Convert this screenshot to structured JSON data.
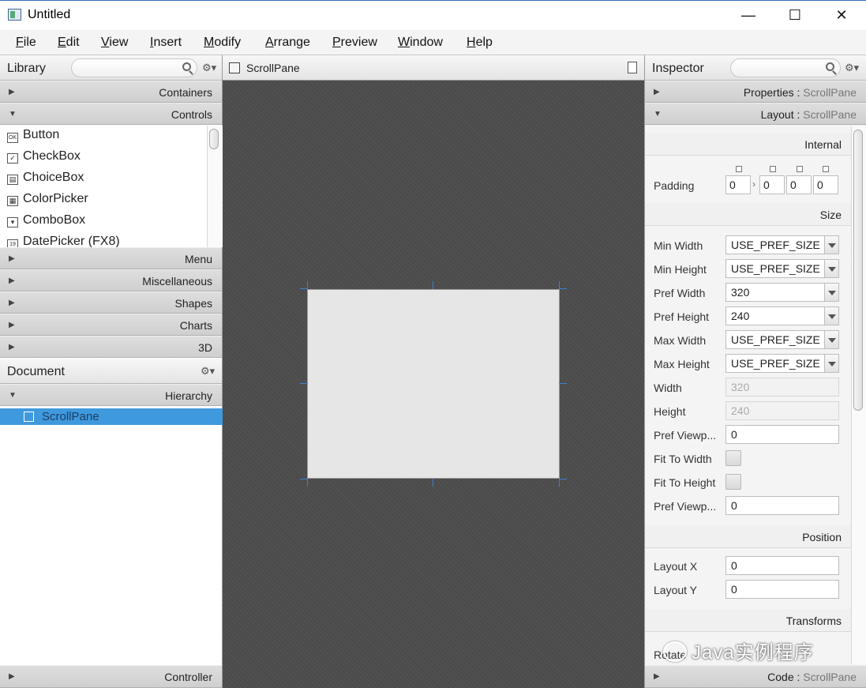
{
  "window": {
    "title": "Untitled",
    "controls": {
      "minimize": "—",
      "maximize": "☐",
      "close": "✕"
    }
  },
  "menubar": {
    "items": [
      {
        "label": "File",
        "u": "F",
        "rest": "ile"
      },
      {
        "label": "Edit",
        "u": "E",
        "rest": "dit"
      },
      {
        "label": "View",
        "u": "V",
        "rest": "iew"
      },
      {
        "label": "Insert",
        "u": "I",
        "rest": "nsert"
      },
      {
        "label": "Modify",
        "u": "M",
        "rest": "odify"
      },
      {
        "label": "Arrange",
        "u": "A",
        "rest": "rrange"
      },
      {
        "label": "Preview",
        "u": "P",
        "rest": "review"
      },
      {
        "label": "Window",
        "u": "W",
        "rest": "indow"
      },
      {
        "label": "Help",
        "u": "H",
        "rest": "elp"
      }
    ]
  },
  "library": {
    "title": "Library",
    "search_value": "",
    "sections": {
      "containers": "Containers",
      "controls": "Controls",
      "menu": "Menu",
      "miscellaneous": "Miscellaneous",
      "shapes": "Shapes",
      "charts": "Charts",
      "three_d": "3D"
    },
    "controls_items": [
      {
        "label": "Button",
        "icon": "ok-button-icon",
        "glyph": "OK"
      },
      {
        "label": "CheckBox",
        "icon": "checkbox-icon",
        "glyph": "✓"
      },
      {
        "label": "ChoiceBox",
        "icon": "choicebox-icon",
        "glyph": "▤"
      },
      {
        "label": "ColorPicker",
        "icon": "colorpicker-icon",
        "glyph": "▦"
      },
      {
        "label": "ComboBox",
        "icon": "combobox-icon",
        "glyph": "▾"
      },
      {
        "label": "DatePicker  (FX8)",
        "icon": "datepicker-icon",
        "glyph": "19"
      }
    ]
  },
  "document": {
    "title": "Document",
    "sections": {
      "hierarchy": "Hierarchy",
      "controller": "Controller"
    },
    "hierarchy_items": [
      {
        "label": "ScrollPane",
        "selected": true
      }
    ]
  },
  "content": {
    "tab_label": "ScrollPane"
  },
  "inspector": {
    "title": "Inspector",
    "search_value": "",
    "sections": {
      "properties": {
        "label": "Properties",
        "sep": " : ",
        "target": "ScrollPane"
      },
      "layout": {
        "label": "Layout",
        "sep": " : ",
        "target": "ScrollPane"
      },
      "code": {
        "label": "Code",
        "sep": " : ",
        "target": "ScrollPane"
      }
    },
    "groups": {
      "internal": "Internal",
      "size": "Size",
      "position": "Position",
      "transforms": "Transforms"
    },
    "padding": {
      "label": "Padding",
      "values": [
        "0",
        "0",
        "0",
        "0"
      ],
      "separator": "›"
    },
    "size_props": [
      {
        "label": "Min Width",
        "type": "combo",
        "value": "USE_PREF_SIZE"
      },
      {
        "label": "Min Height",
        "type": "combo",
        "value": "USE_PREF_SIZE"
      },
      {
        "label": "Pref Width",
        "type": "combo",
        "value": "320"
      },
      {
        "label": "Pref Height",
        "type": "combo",
        "value": "240"
      },
      {
        "label": "Max Width",
        "type": "combo",
        "value": "USE_PREF_SIZE"
      },
      {
        "label": "Max Height",
        "type": "combo",
        "value": "USE_PREF_SIZE"
      },
      {
        "label": "Width",
        "type": "disabled",
        "value": "320"
      },
      {
        "label": "Height",
        "type": "disabled",
        "value": "240"
      },
      {
        "label": "Pref Viewp...",
        "type": "text",
        "value": "0"
      },
      {
        "label": "Fit To Width",
        "type": "check",
        "value": ""
      },
      {
        "label": "Fit To Height",
        "type": "check",
        "value": ""
      },
      {
        "label": "Pref Viewp...",
        "type": "text",
        "value": "0"
      }
    ],
    "position_props": [
      {
        "label": "Layout X",
        "value": "0"
      },
      {
        "label": "Layout Y",
        "value": "0"
      }
    ],
    "transform_partial_label": "Rotate"
  },
  "watermark": {
    "text": "Java实例程序"
  },
  "colors": {
    "selection": "#3f99dd",
    "handle": "#3a7fd8",
    "canvas_bg": "#4a4a4a"
  }
}
